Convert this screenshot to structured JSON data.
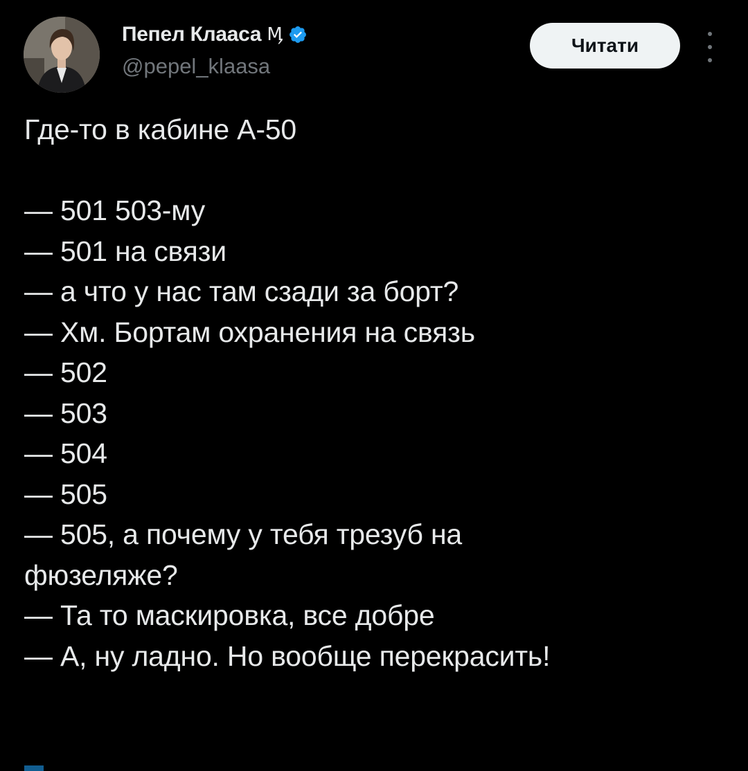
{
  "author": {
    "display_name": "Пепел Клааса",
    "name_glyph": "Ӎ",
    "handle": "@pepel_klaasa",
    "verified_icon": "verified-badge-icon"
  },
  "header": {
    "follow_label": "Читати",
    "more_icon": "more-vertical-icon"
  },
  "tweet": {
    "lines": [
      "Где-то в кабине А-50",
      "",
      "— 501 503-му",
      "— 501 на связи",
      "— а что у нас там сзади за борт?",
      "— Хм. Бортам охранения на связь",
      "— 502",
      "— 503",
      "— 504",
      "— 505",
      "— 505, а почему у тебя трезуб на",
      "фюзеляже?",
      "— Та то маскировка, все добре",
      "— А, ну ладно. Но вообще перекрасить!"
    ]
  },
  "colors": {
    "background": "#000000",
    "text_primary": "#e7e9ea",
    "text_secondary": "#71767b",
    "verified": "#1d9bf0",
    "button_bg": "#eff3f4",
    "button_text": "#0f1419"
  }
}
